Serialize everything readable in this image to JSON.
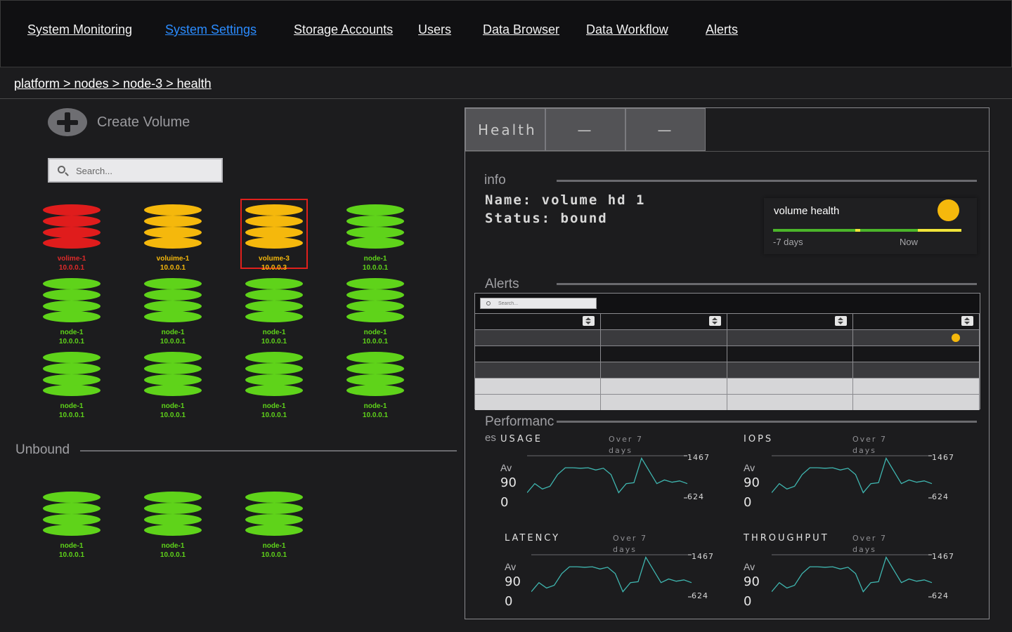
{
  "nav": {
    "items": [
      "System Monitoring",
      "System Settings",
      "Storage Accounts",
      "Users",
      "Data Browser",
      "Data Workflow",
      "Alerts"
    ],
    "active": "System Settings"
  },
  "breadcrumb": "platform > nodes > node-3 > health",
  "left": {
    "create_label": "Create Volume",
    "search_placeholder": "Search...",
    "volumes": [
      {
        "name": "volime-1",
        "ip": "10.0.0.1",
        "status": "red"
      },
      {
        "name": "voluime-1",
        "ip": "10.0.0.1",
        "status": "yellow"
      },
      {
        "name": "volume-3",
        "ip": "10.0.0.3",
        "status": "yellow",
        "selected": true
      },
      {
        "name": "node-1",
        "ip": "10.0.0.1",
        "status": "green"
      },
      {
        "name": "node-1",
        "ip": "10.0.0.1",
        "status": "green"
      },
      {
        "name": "node-1",
        "ip": "10.0.0.1",
        "status": "green"
      },
      {
        "name": "node-1",
        "ip": "10.0.0.1",
        "status": "green"
      },
      {
        "name": "node-1",
        "ip": "10.0.0.1",
        "status": "green"
      },
      {
        "name": "node-1",
        "ip": "10.0.0.1",
        "status": "green"
      },
      {
        "name": "node-1",
        "ip": "10.0.0.1",
        "status": "green"
      },
      {
        "name": "node-1",
        "ip": "10.0.0.1",
        "status": "green"
      },
      {
        "name": "node-1",
        "ip": "10.0.0.1",
        "status": "green"
      }
    ],
    "unbound_title": "Unbound",
    "unbound": [
      {
        "name": "node-1",
        "ip": "10.0.0.1",
        "status": "green"
      },
      {
        "name": "node-1",
        "ip": "10.0.0.1",
        "status": "green"
      },
      {
        "name": "node-1",
        "ip": "10.0.0.1",
        "status": "green"
      }
    ]
  },
  "panel": {
    "tabs": [
      "Health",
      "—",
      "—"
    ],
    "info_title": "info",
    "name_line": "Name: volume hd 1",
    "status_line": "Status: bound",
    "volume_health": {
      "title": "volume health",
      "left_label": "-7 days",
      "right_label": "Now"
    },
    "alerts_title": "Alerts",
    "alerts_search_placeholder": "Search...",
    "perf_title_a": "Performanc",
    "perf_title_b": "es",
    "metrics": [
      {
        "title": "USAGE",
        "sub": "Over 7 days",
        "av": "Av",
        "value": "900",
        "top_tick": "1467",
        "bottom_tick": "624"
      },
      {
        "title": "IOPS",
        "sub": "Over 7 days",
        "av": "Av",
        "value": "900",
        "top_tick": "1467",
        "bottom_tick": "624"
      },
      {
        "title": "LATENCY",
        "sub": "Over 7 days",
        "av": "Av",
        "value": "900",
        "top_tick": "1467",
        "bottom_tick": "624"
      },
      {
        "title": "THROUGHPUT",
        "sub": "Over 7 days",
        "av": "Av",
        "value": "900",
        "top_tick": "1467",
        "bottom_tick": "624"
      }
    ],
    "sparkline": [
      700,
      900,
      780,
      840,
      1100,
      1250,
      1250,
      1240,
      1250,
      1200,
      1240,
      1100,
      700,
      900,
      920,
      1460,
      1180,
      900,
      980,
      930,
      960,
      900
    ]
  },
  "colors": {
    "red": "#e01c1c",
    "yellow": "#f5b80c",
    "green": "#5fd31a",
    "link_active": "#2b8cff",
    "spark": "#3fb6b0"
  },
  "icons": {
    "create": "plus-circle-icon",
    "search": "search-icon",
    "sort": "sort-icon"
  }
}
